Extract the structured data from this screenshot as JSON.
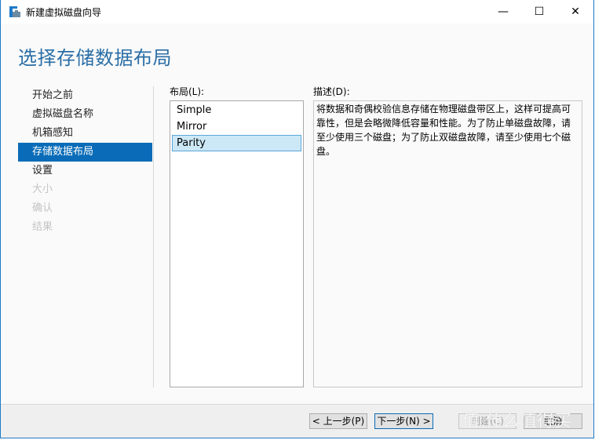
{
  "window": {
    "title": "新建虚拟磁盘向导",
    "controls": {
      "minimize": "—",
      "maximize": "☐",
      "close": "✕"
    }
  },
  "header": {
    "title": "选择存储数据布局"
  },
  "nav": {
    "items": [
      {
        "label": "开始之前",
        "state": "normal"
      },
      {
        "label": "虚拟磁盘名称",
        "state": "normal"
      },
      {
        "label": "机箱感知",
        "state": "normal"
      },
      {
        "label": "存储数据布局",
        "state": "active"
      },
      {
        "label": "设置",
        "state": "normal"
      },
      {
        "label": "大小",
        "state": "disabled"
      },
      {
        "label": "确认",
        "state": "disabled"
      },
      {
        "label": "结果",
        "state": "disabled"
      }
    ]
  },
  "layout": {
    "label": "布局(L):",
    "options": [
      "Simple",
      "Mirror",
      "Parity"
    ],
    "selected": "Parity"
  },
  "description": {
    "label": "描述(D):",
    "text": "将数据和奇偶校验信息存储在物理磁盘带区上，这样可提高可靠性，但是会略微降低容量和性能。为了防止单磁盘故障，请至少使用三个磁盘；为了防止双磁盘故障，请至少使用七个磁盘。"
  },
  "footer": {
    "prev": "< 上一步(P)",
    "next": "下一步(N) >",
    "create": "创建(C)",
    "cancel": "取消"
  },
  "watermark": "值 什么值得买",
  "colors": {
    "accent": "#0a6cb8",
    "header": "#2a6ea6",
    "selection": "#cce8f6"
  }
}
